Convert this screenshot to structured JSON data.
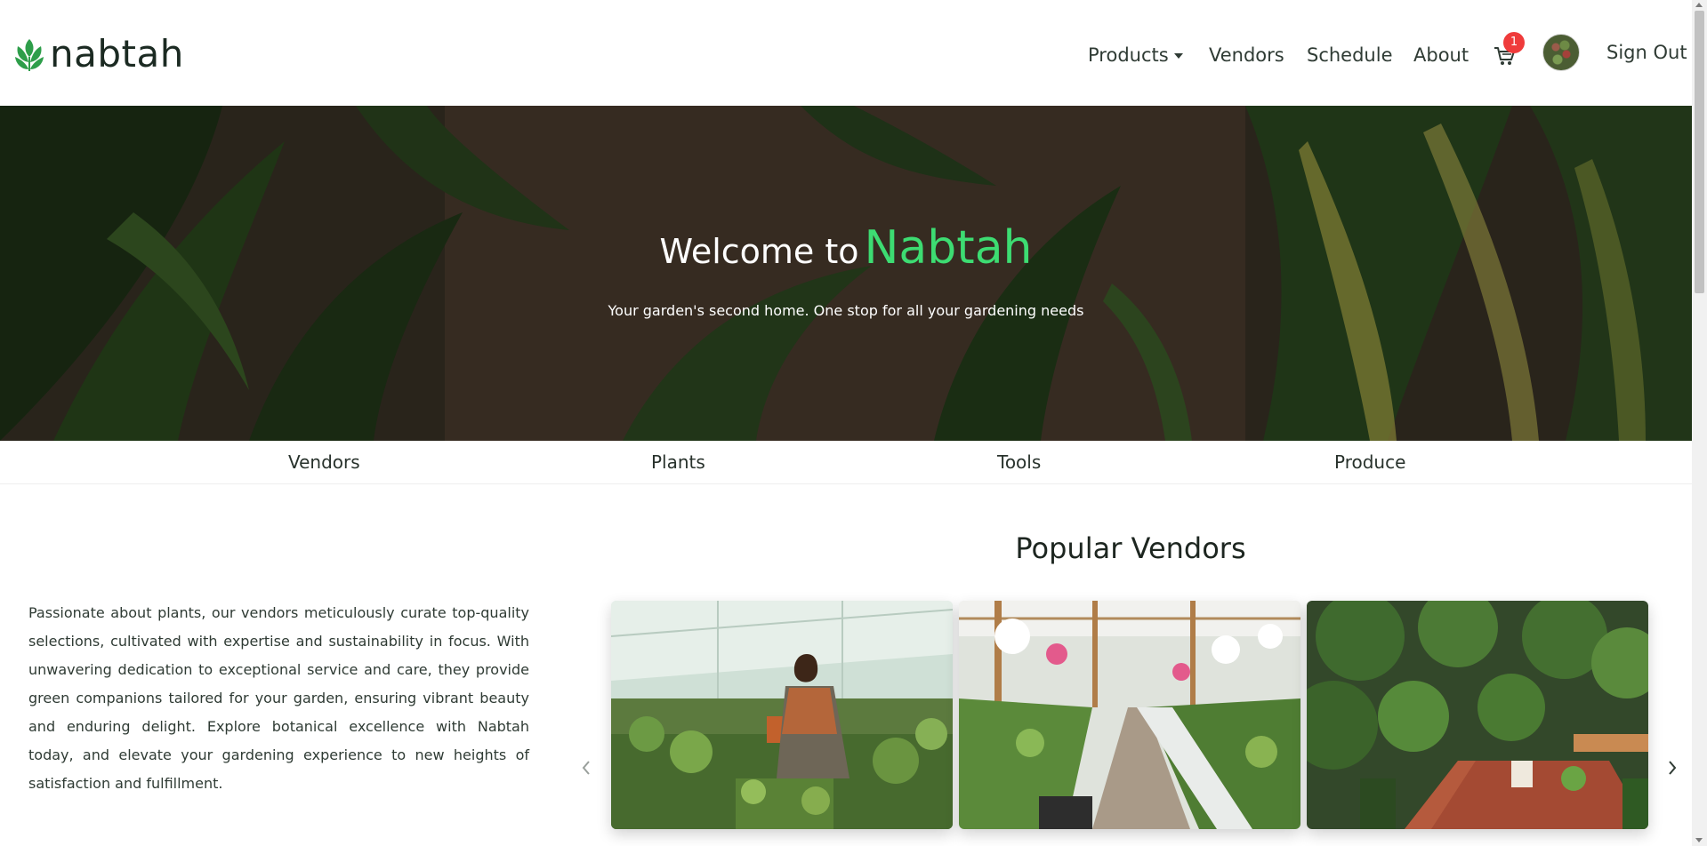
{
  "brand": {
    "name": "nabtah",
    "icon": "leaf-logo-icon",
    "color": "#2e9e4a"
  },
  "nav": {
    "products": "Products",
    "vendors": "Vendors",
    "schedule": "Schedule",
    "about": "About",
    "cart_count": "1",
    "sign_out": "Sign Out"
  },
  "hero": {
    "title_prefix": "Welcome to",
    "title_accent": "Nabtah",
    "subtitle": "Your garden's second home. One stop for all your gardening needs",
    "accent_color": "#3ddc72"
  },
  "categories": [
    "Vendors",
    "Plants",
    "Tools",
    "Produce"
  ],
  "vendors_section": {
    "title": "Popular Vendors",
    "description": "Passionate about plants, our vendors meticulously curate top-quality selections, cultivated with expertise and sustainability in focus. With unwavering dedication to exceptional service and care, they provide green companions tailored for your garden, ensuring vibrant beauty and enduring delight. Explore botanical excellence with Nabtah today, and elevate your gardening experience to new heights of satisfaction and fulfillment."
  }
}
